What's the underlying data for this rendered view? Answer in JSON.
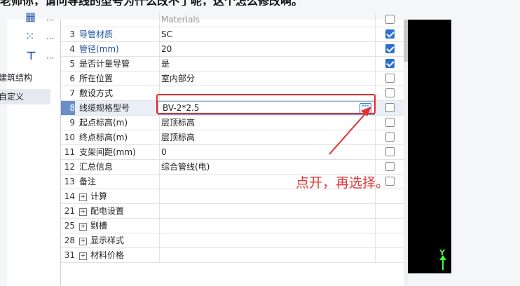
{
  "caption": "老师你，请问导线的型号为什么改不了呢，这个怎么修改啊。",
  "left_panel": {
    "tabs": [
      {
        "label": "建筑结构"
      },
      {
        "label": "自定义"
      }
    ],
    "dots": "···"
  },
  "rows": [
    {
      "num": "",
      "name": "",
      "value": "Materials",
      "checked": false,
      "partial": true
    },
    {
      "num": "3",
      "name": "导管材质",
      "value": "SC",
      "checked": true,
      "blue": true
    },
    {
      "num": "4",
      "name": "管径(mm)",
      "value": "20",
      "checked": true,
      "blue": true
    },
    {
      "num": "5",
      "name": "是否计量导管",
      "value": "是",
      "checked": true
    },
    {
      "num": "6",
      "name": "所在位置",
      "value": "室内部分",
      "checked": false
    },
    {
      "num": "7",
      "name": "敷设方式",
      "value": "",
      "checked": false
    },
    {
      "num": "8",
      "name": "线缆规格型号",
      "value": "BV-2*2.5",
      "checked": false,
      "selected": true
    },
    {
      "num": "9",
      "name": "起点标高(m)",
      "value": "层顶标高",
      "checked": false
    },
    {
      "num": "10",
      "name": "终点标高(m)",
      "value": "层顶标高",
      "checked": false
    },
    {
      "num": "11",
      "name": "支架间距(mm)",
      "value": "0",
      "checked": false
    },
    {
      "num": "12",
      "name": "汇总信息",
      "value": "综合管线(电)",
      "checked": false
    },
    {
      "num": "13",
      "name": "备注",
      "value": "",
      "checked": false
    },
    {
      "num": "14",
      "name": "计算",
      "group": true
    },
    {
      "num": "21",
      "name": "配电设置",
      "group": true
    },
    {
      "num": "25",
      "name": "剔槽",
      "group": true
    },
    {
      "num": "28",
      "name": "显示样式",
      "group": true
    },
    {
      "num": "31",
      "name": "材料价格",
      "group": true
    }
  ],
  "annotation": "点开，再选择。",
  "ellipsis": "···",
  "axis_label": "Y",
  "colors": {
    "accent": "#2e6fd0",
    "annotation_red": "#e03030",
    "axis_green": "#3dff3d"
  }
}
